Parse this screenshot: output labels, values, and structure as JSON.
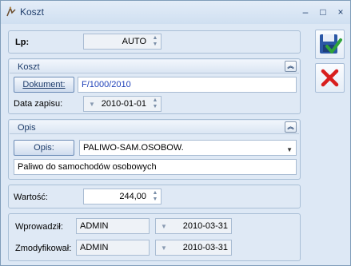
{
  "window": {
    "title": "Koszt",
    "controls": {
      "minimize": "–",
      "maximize": "□",
      "close": "×"
    },
    "close_icon": "close-icon"
  },
  "header": {
    "lp_label": "Lp:",
    "lp_value": "AUTO"
  },
  "koszt_group": {
    "title": "Koszt",
    "collapse": "collapse-icon",
    "dokument_button": "Dokument:",
    "dokument_value": "F/1000/2010",
    "data_zapisu_label": "Data zapisu:",
    "data_zapisu_value": "2010-01-01"
  },
  "opis_group": {
    "title": "Opis",
    "collapse": "collapse-icon",
    "opis_button": "Opis:",
    "opis_selected": "PALIWO-SAM.OSOBOW.",
    "opis_text": "Paliwo do samochodów osobowych"
  },
  "wartosc": {
    "label": "Wartość:",
    "value": "244,00"
  },
  "audit": {
    "wprowadzil_label": "Wprowadził:",
    "wprowadzil_user": "ADMIN",
    "wprowadzil_date": "2010-03-31",
    "zmodyfikowal_label": "Zmodyfikował:",
    "zmodyfikowal_user": "ADMIN",
    "zmodyfikowal_date": "2010-03-31"
  },
  "actions": {
    "save_icon": "save-icon",
    "cancel_icon": "cancel-icon"
  },
  "colors": {
    "accent": "#1e3d6b",
    "check_green": "#2fa33a",
    "cancel_red": "#d81e1e",
    "link_blue": "#1d3fb8"
  }
}
